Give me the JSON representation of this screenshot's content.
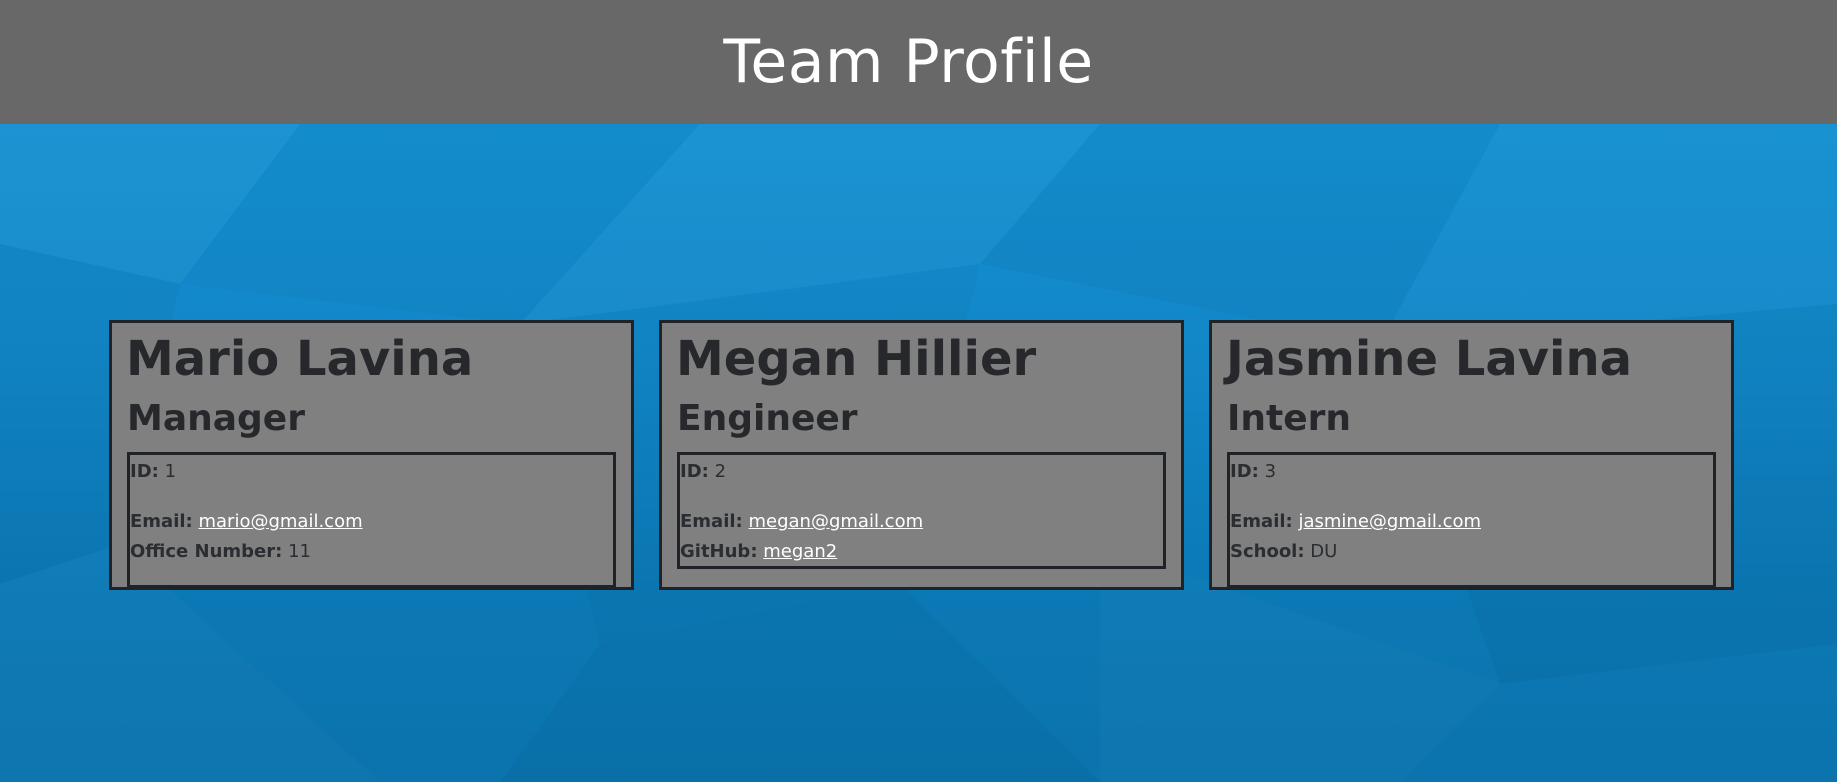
{
  "header": {
    "title": "Team Profile"
  },
  "members": [
    {
      "name": "Mario Lavina",
      "role": "Manager",
      "id_label": "ID:",
      "id": "1",
      "email_label": "Email:",
      "email": "mario@gmail.com",
      "extra_label": "Office Number:",
      "extra_value": "11"
    },
    {
      "name": "Megan Hillier",
      "role": "Engineer",
      "id_label": "ID:",
      "id": "2",
      "email_label": "Email:",
      "email": "megan@gmail.com",
      "extra_label": "GitHub:",
      "extra_value": "megan2"
    },
    {
      "name": "Jasmine Lavina",
      "role": "Intern",
      "id_label": "ID:",
      "id": "3",
      "email_label": "Email:",
      "email": "jasmine@gmail.com",
      "extra_label": "School:",
      "extra_value": "DU"
    }
  ]
}
